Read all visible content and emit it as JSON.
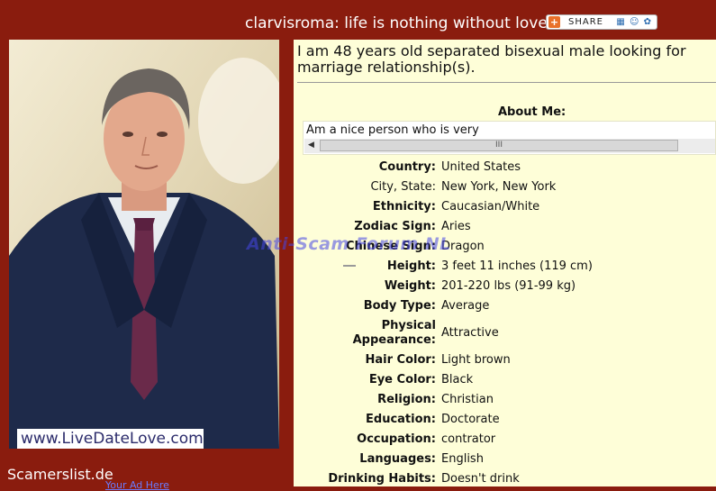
{
  "header": {
    "title": "clarvisroma: life is nothing without love",
    "share_label": "SHARE",
    "share_icons": "▦ ☺ ✿"
  },
  "photo": {
    "caption": "www.LiveDateLove.com"
  },
  "footer": {
    "site": "Scamerslist.de",
    "ad_link": "Your Ad Here"
  },
  "watermark": "Anti-Scam Forum NL",
  "profile": {
    "headline": "I am 48 years old separated bisexual male looking for marriage relationship(s).",
    "about_title": "About Me:",
    "about_text": "Am a nice person who is very",
    "scroll_grip": "III",
    "fields": [
      {
        "key": "Country:",
        "value": "United States"
      },
      {
        "key": "City, State:",
        "value": "New York, New York"
      },
      {
        "key": "Ethnicity:",
        "value": "Caucasian/White"
      },
      {
        "key": "Zodiac Sign:",
        "value": "Aries"
      },
      {
        "key": "Chinese Sign:",
        "value": "Dragon"
      },
      {
        "key": "Height:",
        "value": "3 feet 11 inches (119 cm)"
      },
      {
        "key": "Weight:",
        "value": "201-220 lbs (91-99 kg)"
      },
      {
        "key": "Body Type:",
        "value": "Average"
      },
      {
        "key": "Physical Appearance:",
        "value": "Attractive"
      },
      {
        "key": "Hair Color:",
        "value": "Light brown"
      },
      {
        "key": "Eye Color:",
        "value": "Black"
      },
      {
        "key": "Religion:",
        "value": "Christian"
      },
      {
        "key": "Education:",
        "value": "Doctorate"
      },
      {
        "key": "Occupation:",
        "value": "contrator"
      },
      {
        "key": "Languages:",
        "value": "English"
      },
      {
        "key": "Drinking Habits:",
        "value": "Doesn't drink"
      }
    ]
  },
  "colors": {
    "background": "#8a1c0e",
    "panel": "#fefed8",
    "watermark": "#4646e6"
  }
}
